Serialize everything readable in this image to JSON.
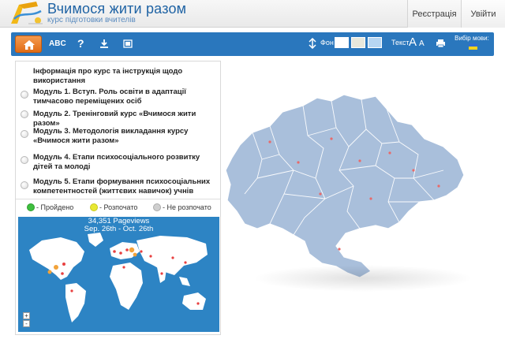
{
  "header": {
    "title": "Вчимося жити разом",
    "subtitle": "курс підготовки вчителів",
    "register_label": "Реєстрація",
    "login_label": "Увійти"
  },
  "toolbar": {
    "abc_label": "ABC",
    "help_label": "?",
    "background_label": "Фон",
    "text_label": "Текст",
    "font_large": "A",
    "font_small": "A",
    "language_label": "Вибір мови:",
    "swatches": [
      "#ffffff",
      "#e8e8dc",
      "#b7d6f2"
    ]
  },
  "modules": [
    {
      "label": "Інформація про курс та інструкція щодо використання",
      "status": "none"
    },
    {
      "label": "Модуль 1. Вступ. Роль освіти в адаптації тимчасово переміщених осіб",
      "status": "not_started"
    },
    {
      "label": "Модуль 2. Тренінговий курс «Вчимося жити разом»",
      "status": "not_started"
    },
    {
      "label": "Модуль 3. Методологія викладання курсу «Вчимося жити разом»",
      "status": "not_started"
    },
    {
      "label": "Модуль 4. Етапи психосоціального розвитку дітей та молоді",
      "status": "not_started"
    },
    {
      "label": "Модуль 5. Етапи формування психосоціальних компетентностей (життєвих навичок) учнів",
      "status": "not_started"
    }
  ],
  "legend": {
    "passed": "- Пройдено",
    "started": "- Розпочато",
    "not_started": "- Не розпочато"
  },
  "colors": {
    "passed": "#3fbf3f",
    "started": "#e8e832",
    "not_started": "#cfcfcf",
    "toolbar": "#2a77bd",
    "accent": "#e57420"
  },
  "pageviews": {
    "count": "34,351 Pageviews",
    "range": "Sep. 26th - Oct. 26th",
    "zoom_in": "+",
    "zoom_out": "-"
  }
}
